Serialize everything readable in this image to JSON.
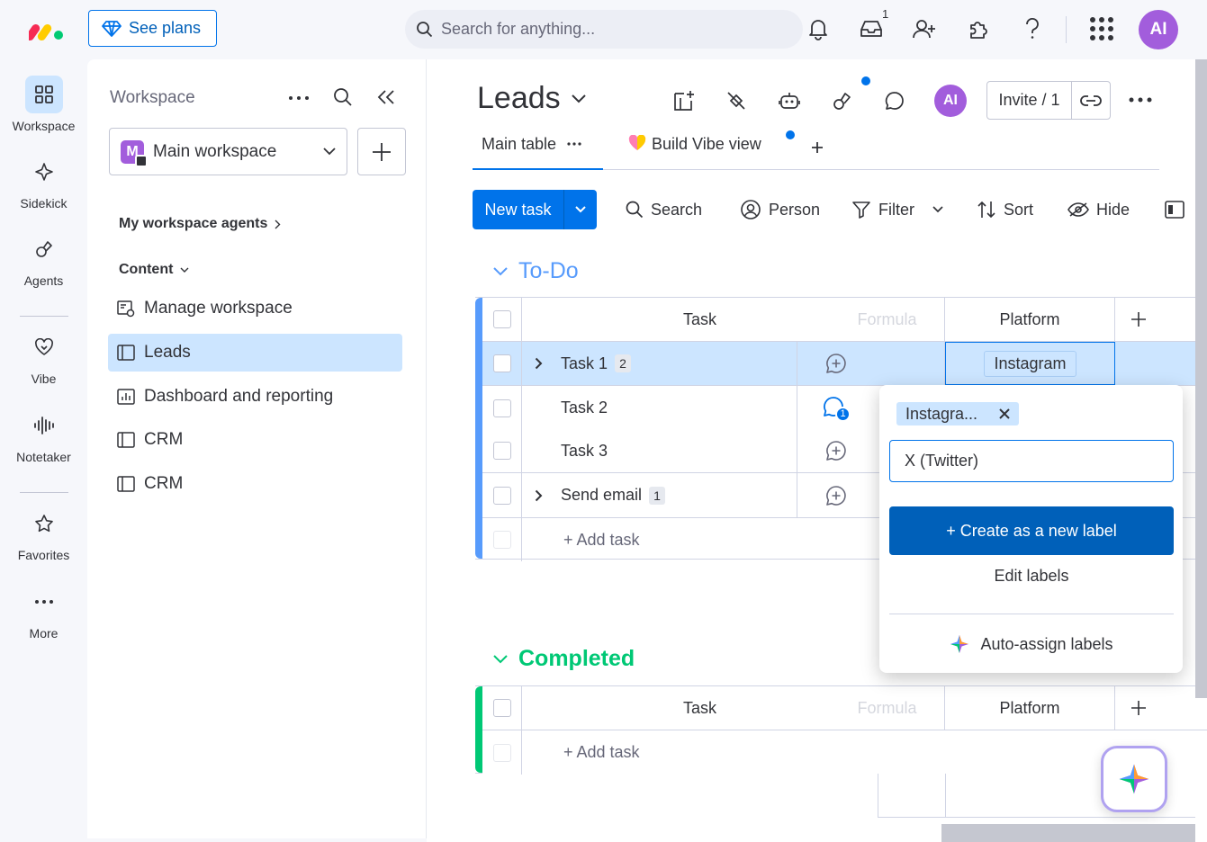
{
  "topbar": {
    "see_plans_label": "See plans",
    "search_placeholder": "Search for anything...",
    "inbox_count": "1",
    "avatar_initials": "AI"
  },
  "rail": {
    "items": [
      {
        "label": "Workspace"
      },
      {
        "label": "Sidekick"
      },
      {
        "label": "Agents"
      },
      {
        "label": "Vibe"
      },
      {
        "label": "Notetaker"
      },
      {
        "label": "Favorites"
      },
      {
        "label": "More"
      }
    ]
  },
  "workspace": {
    "title": "Workspace",
    "selected": "Main workspace",
    "badge_letter": "M",
    "agents_label": "My workspace agents",
    "content_label": "Content",
    "items": [
      {
        "label": "Manage workspace"
      },
      {
        "label": "Leads"
      },
      {
        "label": "Dashboard and reporting"
      },
      {
        "label": "CRM"
      },
      {
        "label": "CRM"
      }
    ]
  },
  "board": {
    "title": "Leads",
    "avatar_initials": "AI",
    "invite_label": "Invite / 1",
    "tabs": [
      {
        "label": "Main table"
      },
      {
        "label": "Build Vibe view"
      }
    ],
    "toolbar": {
      "new_task": "New task",
      "search": "Search",
      "person": "Person",
      "filter": "Filter",
      "sort": "Sort",
      "hide": "Hide"
    },
    "columns": {
      "task": "Task",
      "formula": "Formula",
      "platform": "Platform"
    },
    "groups": [
      {
        "title": "To-Do",
        "color": "#579bfc",
        "rows": [
          {
            "task": "Task 1",
            "subitems": "2",
            "platform": "Instagram"
          },
          {
            "task": "Task 2",
            "updates": "1",
            "platform": ""
          },
          {
            "task": "Task 3",
            "platform": ""
          },
          {
            "task": "Send email",
            "subitems": "1",
            "platform": ""
          }
        ],
        "add_task": "+ Add task"
      },
      {
        "title": "Completed",
        "color": "#00c875",
        "rows": [],
        "add_task": "+ Add task"
      }
    ]
  },
  "label_popover": {
    "chip_label": "Instagra...",
    "input_value": "X (Twitter)",
    "create_label": "+ Create as a new label",
    "edit_labels": "Edit labels",
    "auto_assign": "Auto-assign labels"
  },
  "colors": {
    "primary": "#0073ea",
    "todo_group": "#579bfc",
    "completed_group": "#00c875",
    "avatar": "#a25ddc"
  }
}
